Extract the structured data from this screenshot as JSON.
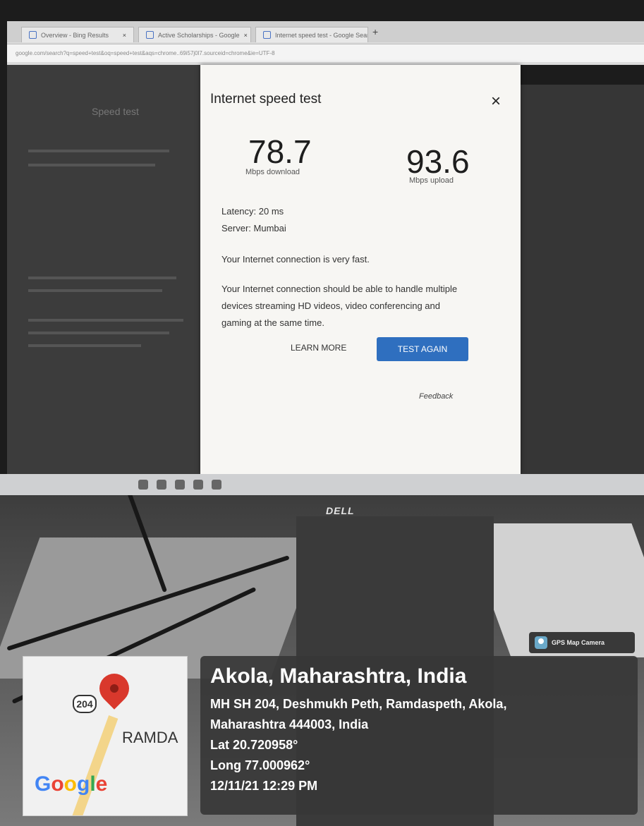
{
  "browser": {
    "tabs": [
      {
        "label": "Overview - Bing Results"
      },
      {
        "label": "Active Scholarships - Google"
      },
      {
        "label": "Internet speed test - Google Sear"
      }
    ],
    "new_tab_symbol": "+",
    "address": "google.com/search?q=speed+test&oq=speed+test&aqs=chrome..69i57j0l7.sourceid=chrome&ie=UTF-8"
  },
  "page": {
    "left_heading": "Speed test"
  },
  "speed_test": {
    "title": "Internet speed test",
    "close_symbol": "×",
    "download": {
      "value": "78.7",
      "label": "Mbps download"
    },
    "upload": {
      "value": "93.6",
      "label": "Mbps upload"
    },
    "latency": "Latency: 20 ms",
    "server": "Server: Mumbai",
    "fast_message": "Your Internet connection is very fast.",
    "detail": "Your Internet connection should be able to handle multiple devices streaming HD videos, video conferencing and gaming at the same time.",
    "learn_more": "LEARN MORE",
    "test_again": "TEST AGAIN",
    "feedback": "Feedback"
  },
  "monitor": {
    "brand": "DELL"
  },
  "gps_overlay": {
    "app_label": "GPS Map Camera",
    "city": "Akola, Maharashtra, India",
    "address_line1": "MH SH 204, Deshmukh Peth, Ramdaspeth, Akola,",
    "address_line2": "Maharashtra 444003, India",
    "latitude": "Lat 20.720958°",
    "longitude": "Long 77.000962°",
    "datetime": "12/11/21 12:29 PM",
    "map": {
      "road_number": "204",
      "place_label": "RAMDA",
      "logo_letters": [
        "G",
        "o",
        "o",
        "g",
        "l",
        "e"
      ]
    }
  }
}
